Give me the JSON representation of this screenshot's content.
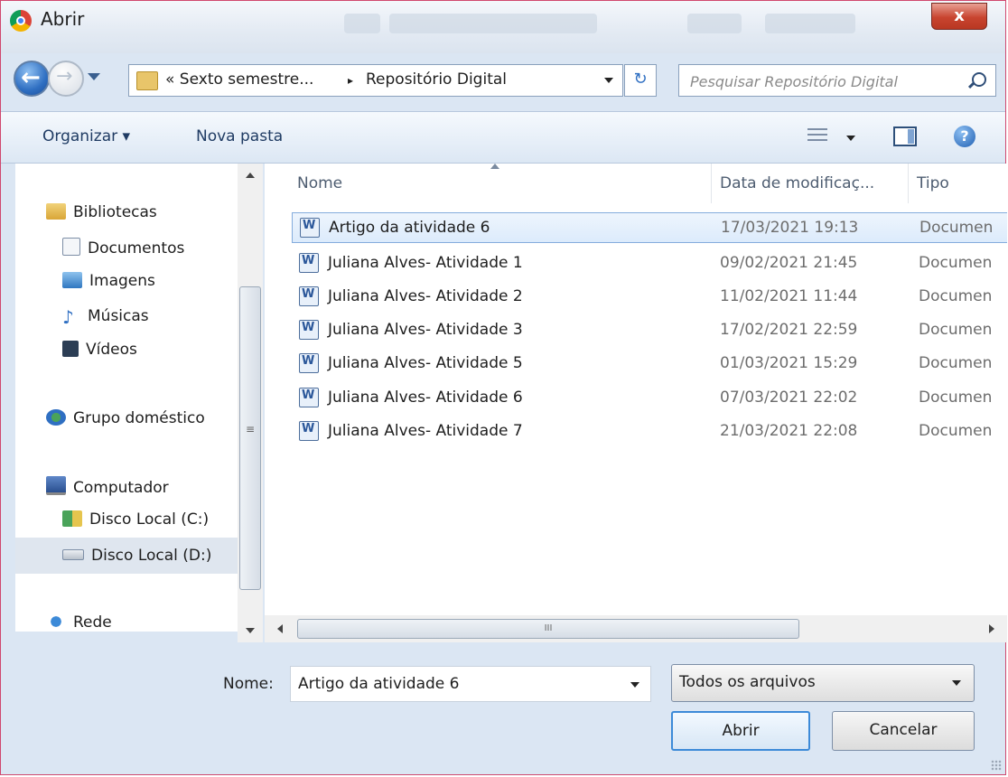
{
  "window": {
    "title": "Abrir",
    "close_label": "x"
  },
  "address_bar": {
    "crumbs": [
      "« Sexto semestre...",
      "▸",
      "Repositório Digital"
    ],
    "refresh_label": "↻"
  },
  "search": {
    "placeholder": "Pesquisar Repositório Digital"
  },
  "toolbar": {
    "organize_label": "Organizar ▾",
    "new_folder_label": "Nova pasta",
    "help_label": "?"
  },
  "nav_pane": {
    "items": [
      {
        "label": "Bibliotecas",
        "icon": "libraries-icon"
      },
      {
        "label": "Documentos",
        "icon": "documents-icon"
      },
      {
        "label": "Imagens",
        "icon": "pictures-icon"
      },
      {
        "label": "Músicas",
        "icon": "music-icon"
      },
      {
        "label": "Vídeos",
        "icon": "videos-icon"
      },
      {
        "label": "Grupo doméstico",
        "icon": "homegroup-icon"
      },
      {
        "label": "Computador",
        "icon": "computer-icon"
      },
      {
        "label": "Disco Local (C:)",
        "icon": "drive-c-icon"
      },
      {
        "label": "Disco Local (D:)",
        "icon": "drive-d-icon"
      },
      {
        "label": "Rede",
        "icon": "network-icon"
      }
    ],
    "selected": "Disco Local (D:)"
  },
  "file_list": {
    "columns": [
      "Nome",
      "Data de modificaç...",
      "Tipo"
    ],
    "rows": [
      {
        "name": "Artigo da atividade 6",
        "date": "17/03/2021 19:13",
        "type": "Documen"
      },
      {
        "name": "Juliana Alves- Atividade 1",
        "date": "09/02/2021 21:45",
        "type": "Documen"
      },
      {
        "name": "Juliana Alves- Atividade 2",
        "date": "11/02/2021 11:44",
        "type": "Documen"
      },
      {
        "name": "Juliana Alves- Atividade 3",
        "date": "17/02/2021 22:59",
        "type": "Documen"
      },
      {
        "name": "Juliana Alves- Atividade 5",
        "date": "01/03/2021 15:29",
        "type": "Documen"
      },
      {
        "name": "Juliana Alves- Atividade 6",
        "date": "07/03/2021 22:02",
        "type": "Documen"
      },
      {
        "name": "Juliana Alves- Atividade 7",
        "date": "21/03/2021 22:08",
        "type": "Documen"
      }
    ],
    "selected_row": "Artigo da atividade 6",
    "hscroll_grip": "III",
    "vscroll_grip": "≡"
  },
  "footer": {
    "filename_label": "Nome:",
    "filename_value": "Artigo da atividade 6",
    "filter_value": "Todos os arquivos",
    "open_button": "Abrir",
    "cancel_button": "Cancelar"
  }
}
